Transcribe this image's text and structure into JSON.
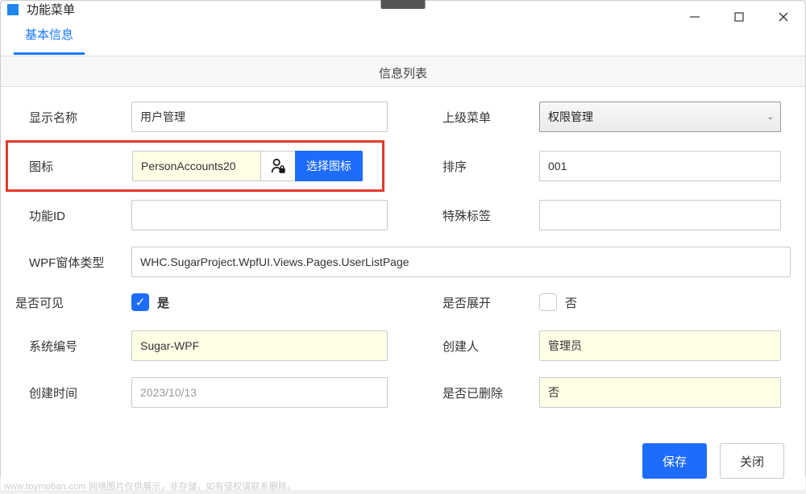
{
  "window": {
    "title": "功能菜单"
  },
  "tabs": {
    "basic_info": "基本信息"
  },
  "panel_title": "信息列表",
  "form": {
    "display_name": {
      "label": "显示名称",
      "value": "用户管理"
    },
    "parent_menu": {
      "label": "上级菜单",
      "selected": "权限管理"
    },
    "icon": {
      "label": "图标",
      "value": "PersonAccounts20",
      "choose_btn": "选择图标"
    },
    "sort": {
      "label": "排序",
      "value": "001"
    },
    "function_id": {
      "label": "功能ID",
      "value": ""
    },
    "special_tag": {
      "label": "特殊标签",
      "value": ""
    },
    "wpf_form": {
      "label": "WPF窗体类型",
      "value": "WHC.SugarProject.WpfUI.Views.Pages.UserListPage"
    },
    "visible": {
      "label": "是否可见",
      "checked_label": "是",
      "checked": true
    },
    "expanded": {
      "label": "是否展开",
      "unchecked_label": "否",
      "checked": false
    },
    "system_no": {
      "label": "系统编号",
      "value": "Sugar-WPF"
    },
    "creator": {
      "label": "创建人",
      "value": "管理员"
    },
    "create_time": {
      "label": "创建时间",
      "value": "2023/10/13"
    },
    "deleted": {
      "label": "是否已删除",
      "value": "否"
    }
  },
  "footer": {
    "save": "保存",
    "close": "关闭"
  },
  "watermark": "www.toymoban.com 网络图片仅供展示，非存储，如有侵权请联系删除。"
}
